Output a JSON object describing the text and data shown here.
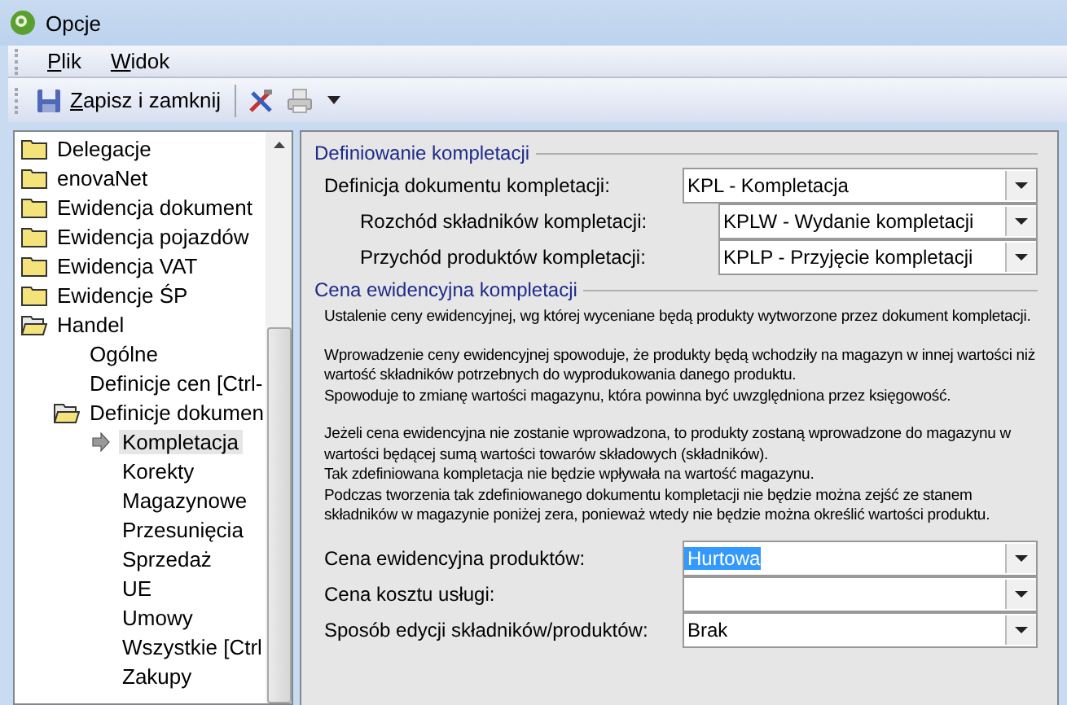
{
  "window": {
    "title": "Opcje"
  },
  "menu": [
    {
      "label": "Plik"
    },
    {
      "label": "Widok"
    }
  ],
  "toolbar": {
    "save_button": {
      "label": "Zapisz i zamknij"
    }
  },
  "tree": [
    {
      "label": "Delegacje",
      "kind": "folder",
      "expanded": false,
      "selected": false
    },
    {
      "label": "enovaNet",
      "kind": "folder",
      "expanded": false,
      "selected": false
    },
    {
      "label": "Ewidencja dokument",
      "kind": "folder",
      "expanded": false,
      "selected": false
    },
    {
      "label": "Ewidencja pojazdów",
      "kind": "folder",
      "expanded": false,
      "selected": false
    },
    {
      "label": "Ewidencja VAT",
      "kind": "folder",
      "expanded": false,
      "selected": false
    },
    {
      "label": "Ewidencje ŚP",
      "kind": "folder",
      "expanded": false,
      "selected": false
    },
    {
      "label": "Handel",
      "kind": "folder",
      "expanded": true,
      "selected": false,
      "children": [
        {
          "label": "Ogólne",
          "kind": "page",
          "selected": false
        },
        {
          "label": "Definicje cen [Ctrl-",
          "kind": "page",
          "selected": false
        },
        {
          "label": "Definicje dokumen",
          "kind": "folder",
          "expanded": true,
          "selected": false,
          "children": [
            {
              "label": "Kompletacja",
              "kind": "page",
              "selected": true
            },
            {
              "label": "Korekty",
              "kind": "page",
              "selected": false
            },
            {
              "label": "Magazynowe",
              "kind": "page",
              "selected": false
            },
            {
              "label": "Przesunięcia",
              "kind": "page",
              "selected": false
            },
            {
              "label": "Sprzedaż",
              "kind": "page",
              "selected": false
            },
            {
              "label": "UE",
              "kind": "page",
              "selected": false
            },
            {
              "label": "Umowy",
              "kind": "page",
              "selected": false
            },
            {
              "label": "Wszystkie [Ctrl",
              "kind": "page",
              "selected": false
            },
            {
              "label": "Zakupy",
              "kind": "page",
              "selected": false
            }
          ]
        }
      ]
    }
  ],
  "definition_group": {
    "title": "Definiowanie kompletacji",
    "fields": [
      {
        "label": "Definicja dokumentu kompletacji:",
        "value": "KPL - Kompletacja",
        "indented": false
      },
      {
        "label": "Rozchód składników kompletacji:",
        "value": "KPLW - Wydanie kompletacji",
        "indented": true
      },
      {
        "label": "Przychód produktów kompletacji:",
        "value": "KPLP - Przyjęcie kompletacji",
        "indented": true
      }
    ]
  },
  "price_group": {
    "title": "Cena ewidencyjna kompletacji",
    "paragraphs": [
      [
        "Ustalenie ceny ewidencyjnej, wg której wyceniane będą produkty wytworzone przez dokument kompletacji."
      ],
      [
        "Wprowadzenie ceny ewidencyjnej spowoduje, że produkty będą wchodziły na magazyn w innej wartości niż wartość składników potrzebnych do wyprodukowania danego produktu.",
        "Spowoduje to zmianę wartości magazynu, która powinna być uwzględniona przez księgowość."
      ],
      [
        "Jeżeli cena ewidencyjna nie zostanie wprowadzona, to produkty zostaną wprowadzone do magazynu w wartości będącej sumą wartości towarów składowych (składników).",
        "Tak zdefiniowana kompletacja nie będzie wpływała na wartość magazynu.",
        "Podczas tworzenia tak zdefiniowanego dokumentu kompletacji nie będzie można zejść ze stanem składników w magazynie poniżej zera, ponieważ wtedy nie będzie można określić wartości produktu."
      ]
    ],
    "fields": [
      {
        "label": "Cena ewidencyjna produktów:",
        "value": "Hurtowa",
        "text_selected": true
      },
      {
        "label": "Cena kosztu usługi:"
      },
      {
        "label": "Sposób edycji składników/produktów:",
        "value": "Brak",
        "text_selected": false
      }
    ]
  }
}
